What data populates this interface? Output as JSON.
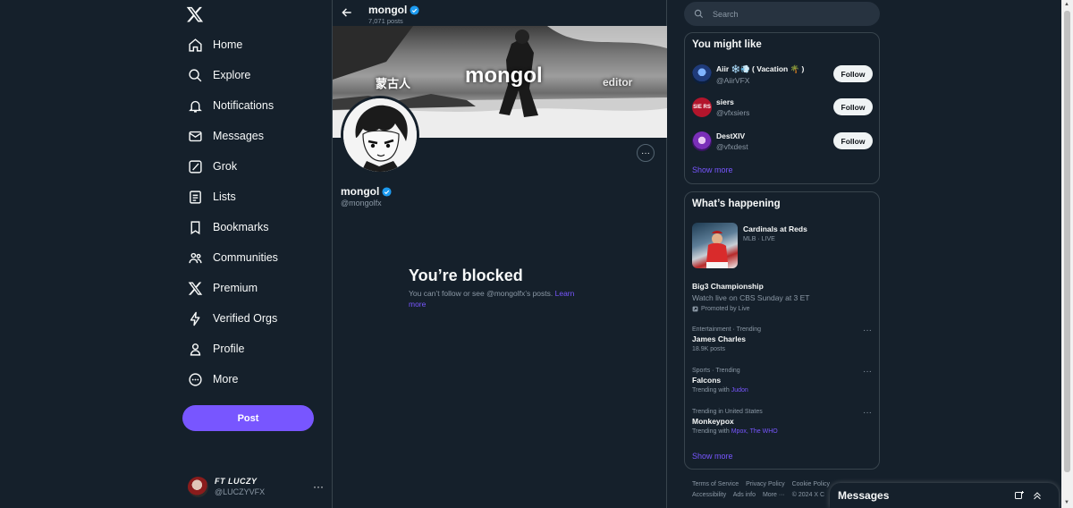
{
  "nav": {
    "items": [
      {
        "label": "Home",
        "icon": "home-icon"
      },
      {
        "label": "Explore",
        "icon": "search-icon"
      },
      {
        "label": "Notifications",
        "icon": "bell-icon"
      },
      {
        "label": "Messages",
        "icon": "envelope-icon"
      },
      {
        "label": "Grok",
        "icon": "grok-icon"
      },
      {
        "label": "Lists",
        "icon": "list-icon"
      },
      {
        "label": "Bookmarks",
        "icon": "bookmark-icon"
      },
      {
        "label": "Communities",
        "icon": "people-icon"
      },
      {
        "label": "Premium",
        "icon": "x-logo-icon"
      },
      {
        "label": "Verified Orgs",
        "icon": "lightning-icon"
      },
      {
        "label": "Profile",
        "icon": "person-icon"
      },
      {
        "label": "More",
        "icon": "more-circle-icon"
      }
    ],
    "post_label": "Post"
  },
  "account": {
    "name": "FT LUCZY",
    "handle": "@LUCZYVFX",
    "more": "···"
  },
  "profile": {
    "top_name": "mongol",
    "posts": "7,071 posts",
    "banner_texts": {
      "main": "mongol",
      "left": "蒙古人",
      "right": "editor"
    },
    "name": "mongol",
    "handle": "@mongolfx",
    "more": "···"
  },
  "blocked": {
    "title": "You’re blocked",
    "text": "You can’t follow or see @mongolfx’s posts.",
    "link": "Learn more"
  },
  "search": {
    "placeholder": "Search"
  },
  "you_might_like": {
    "title": "You might like",
    "accounts": [
      {
        "name": "Aiir ❄️💨 ( Vacation 🌴 )",
        "handle": "@AiirVFX",
        "button": "Follow"
      },
      {
        "name": "siers",
        "handle": "@vfxsiers",
        "button": "Follow",
        "avatar_text": "SIE RS"
      },
      {
        "name": "DestXIV",
        "handle": "@vfxdest",
        "button": "Follow"
      }
    ],
    "show_more": "Show more"
  },
  "whats_happening": {
    "title": "What’s happening",
    "event": {
      "title": "Cardinals at Reds",
      "meta": "MLB · LIVE"
    },
    "promoted": {
      "title": "Big3 Championship",
      "text": "Watch live on CBS Sunday at 3 ET",
      "promoted_by": "Promoted by Live"
    },
    "trends": [
      {
        "meta": "Entertainment · Trending",
        "title": "James Charles",
        "sub": "18.9K posts"
      },
      {
        "meta": "Sports · Trending",
        "title": "Falcons",
        "sub_prefix": "Trending with",
        "sub_links": "Judon"
      },
      {
        "meta": "Trending in United States",
        "title": "Monkeypox",
        "sub_prefix": "Trending with",
        "sub_links": "Mpox, The WHO"
      }
    ],
    "show_more": "Show more"
  },
  "footer": {
    "line1": [
      "Terms of Service",
      "Privacy Policy",
      "Cookie Policy"
    ],
    "line2": [
      "Accessibility",
      "Ads info",
      "More ···",
      "© 2024 X C"
    ]
  },
  "messages_drawer": {
    "title": "Messages"
  },
  "colors": {
    "accent": "#7856ff",
    "background": "#15202b",
    "border": "#38444d",
    "verified": "#1d9bf0"
  }
}
